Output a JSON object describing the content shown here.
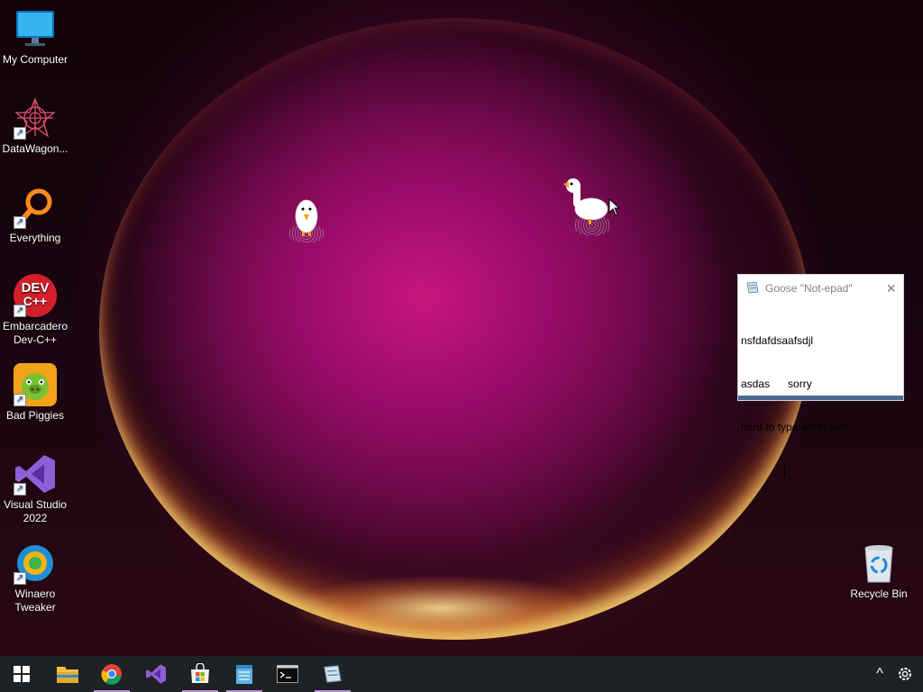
{
  "desktop": {
    "icons": [
      {
        "label": "My Computer"
      },
      {
        "label": "DataWagon..."
      },
      {
        "label": "Everything"
      },
      {
        "label": "Embarcadero Dev-C++"
      },
      {
        "label": "Bad Piggies"
      },
      {
        "label": "Visual Studio 2022"
      },
      {
        "label": "Winaero Tweaker"
      },
      {
        "label": "Recycle Bin"
      }
    ],
    "devcpp_logo": {
      "line1": "DEV",
      "line2": "C++"
    }
  },
  "notepad": {
    "title": "Goose \"Not-epad\"",
    "close_glyph": "×",
    "lines": [
      "nsfdafdsaafsdjl",
      "asdas      sorry",
      "hard to type withh feet"
    ]
  },
  "taskbar": {
    "apps": [
      "start",
      "file-explorer",
      "chrome",
      "visual-studio",
      "microsoft-store",
      "notepad",
      "terminal",
      "goose-notepad"
    ],
    "tray_chevron": "^"
  }
}
